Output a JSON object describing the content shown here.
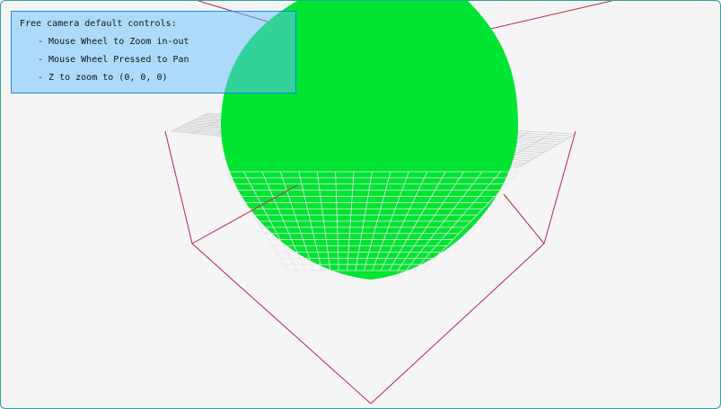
{
  "window": {
    "background": "#f5f5f5",
    "border_color": "#2fa39a"
  },
  "scene": {
    "object": "sphere",
    "sphere_color": "#00e432",
    "bounding_box_color": "#b8283d",
    "grid_color": "#c8c8c8"
  },
  "help_panel": {
    "title": "Free camera default controls:",
    "items": [
      "- Mouse Wheel to Zoom in-out",
      "- Mouse Wheel Pressed to Pan",
      "- Z to zoom to (0, 0, 0)"
    ],
    "background": "#66bfff",
    "border": "#0079f1"
  }
}
